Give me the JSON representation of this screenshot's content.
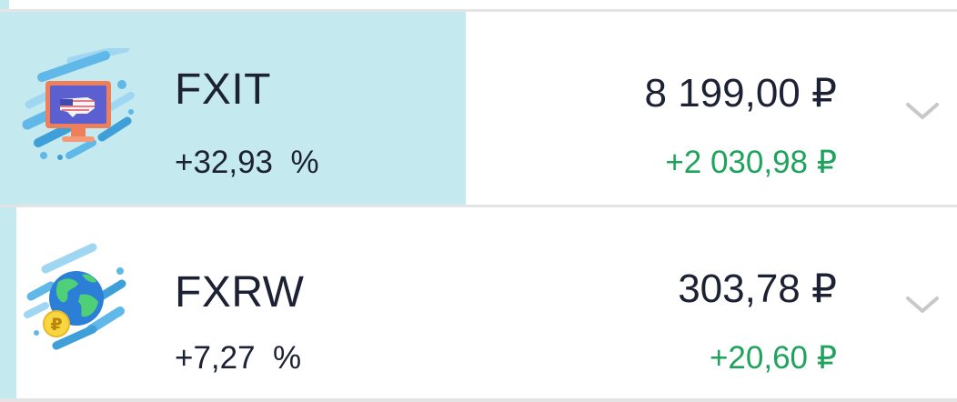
{
  "holdings": [
    {
      "ticker": "FXIT",
      "percent": "+32,93  %",
      "value": "8 199,00 ₽",
      "gain": "+2 030,98 ₽",
      "icon": "us-flag-monitor-icon",
      "highlight_fraction": 0.487
    },
    {
      "ticker": "FXRW",
      "percent": "+7,27  %",
      "value": "303,78 ₽",
      "gain": "+20,60 ₽",
      "icon": "globe-ruble-icon",
      "highlight_fraction": 0.017
    }
  ],
  "colors": {
    "highlight": "#c4e9ee",
    "text": "#1c2134",
    "gain": "#1ea35c",
    "chevron": "#c8c8c8",
    "divider": "#e4e4e4"
  }
}
